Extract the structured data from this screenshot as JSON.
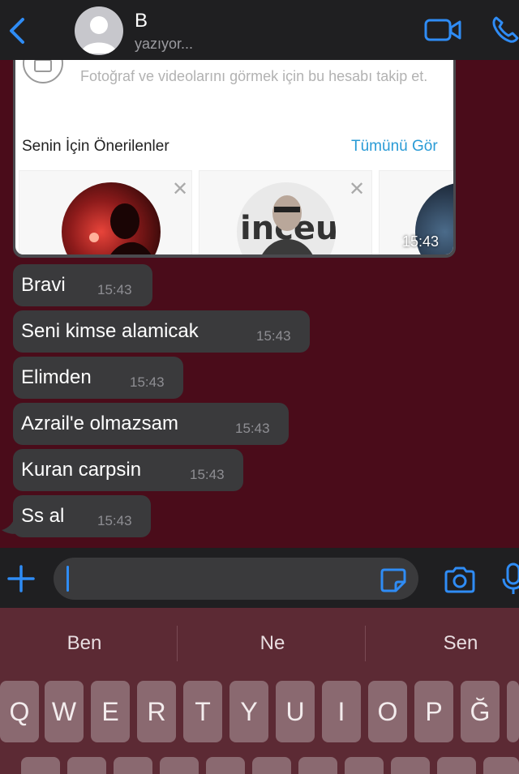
{
  "header": {
    "back_icon": "chevron-left-icon",
    "contact_name": "B",
    "contact_status": "yazıyor...",
    "video_icon": "video-camera-icon",
    "call_icon": "phone-icon",
    "accent_color": "#2f8cf5"
  },
  "shared_card": {
    "private_text": "Fotoğraf ve videolarını görmek için bu hesabı takip et.",
    "suggestions_title": "Senin İçin Önerilenler",
    "see_all_label": "Tümünü Gör",
    "dismiss_icon": "close-icon",
    "time": "15:43"
  },
  "messages": [
    {
      "text": "Bravi",
      "time": "15:43"
    },
    {
      "text": "Seni kimse alamicak",
      "time": "15:43"
    },
    {
      "text": "Elimden",
      "time": "15:43"
    },
    {
      "text": "Azrail'e olmazsam",
      "time": "15:43"
    },
    {
      "text": "Kuran carpsin",
      "time": "15:43"
    },
    {
      "text": "Ss al",
      "time": "15:43"
    }
  ],
  "input_bar": {
    "plus_icon": "plus-icon",
    "message_value": "",
    "sticker_icon": "sticker-icon",
    "camera_icon": "camera-icon",
    "mic_icon": "microphone-icon"
  },
  "keyboard": {
    "suggestions": [
      "Ben",
      "Ne",
      "Sen"
    ],
    "row1": [
      "Q",
      "W",
      "E",
      "R",
      "T",
      "Y",
      "U",
      "I",
      "O",
      "P",
      "Ğ"
    ]
  }
}
